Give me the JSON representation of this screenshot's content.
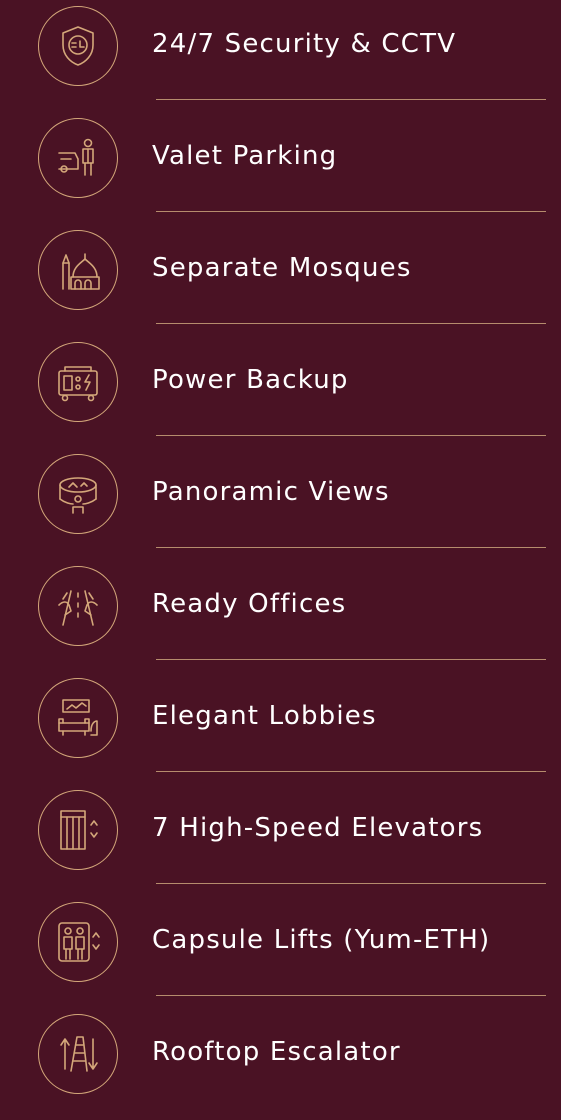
{
  "amenities": [
    {
      "icon": "security-shield-icon",
      "label": "24/7 Security & CCTV"
    },
    {
      "icon": "valet-parking-icon",
      "label": "Valet Parking"
    },
    {
      "icon": "mosque-icon",
      "label": "Separate Mosques"
    },
    {
      "icon": "power-generator-icon",
      "label": "Power Backup"
    },
    {
      "icon": "panoramic-view-icon",
      "label": "Panoramic Views"
    },
    {
      "icon": "office-handshake-icon",
      "label": "Ready Offices"
    },
    {
      "icon": "lobby-sofa-icon",
      "label": "Elegant Lobbies"
    },
    {
      "icon": "elevator-icon",
      "label": "7 High-Speed Elevators"
    },
    {
      "icon": "capsule-lift-icon",
      "label": "Capsule Lifts (Yum-ETH)"
    },
    {
      "icon": "escalator-icon",
      "label": "Rooftop Escalator"
    }
  ],
  "colors": {
    "background": "#4a1224",
    "accent": "#d4a77a",
    "text": "#ffffff"
  }
}
